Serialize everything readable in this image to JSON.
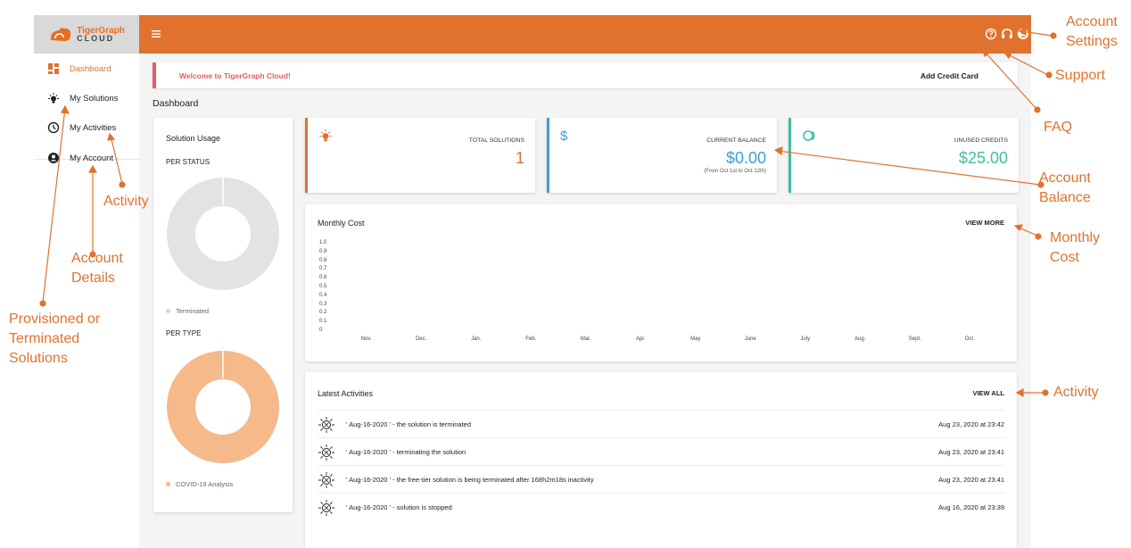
{
  "brand": {
    "name_top": "TigerGraph",
    "name_bottom": "CLOUD"
  },
  "colors": {
    "accent": "#e0722e",
    "welcome": "#e35d64",
    "balance": "#3aa0d8",
    "credits": "#3dbfa0",
    "donut_gray": "#e3e3e3",
    "donut_orange": "#f5b98a"
  },
  "topbar": {
    "icons": [
      "menu-icon",
      "help-icon",
      "headset-icon",
      "account-circle-icon"
    ]
  },
  "sidebar": {
    "items": [
      {
        "label": "Dashboard",
        "icon": "dashboard-icon",
        "active": true
      },
      {
        "label": "My Solutions",
        "icon": "solution-icon",
        "active": false
      },
      {
        "label": "My Activities",
        "icon": "clock-icon",
        "active": false
      },
      {
        "label": "My Account",
        "icon": "account-circle-icon",
        "active": false
      }
    ]
  },
  "welcome": {
    "text": "Welcome to TigerGraph Cloud!",
    "action": "Add Credit Card"
  },
  "page_title": "Dashboard",
  "usage": {
    "title": "Solution Usage",
    "per_status": "PER STATUS",
    "status_legend": "Terminated",
    "per_type": "PER TYPE",
    "type_legend": "COVID-19 Analysis"
  },
  "stats": [
    {
      "label": "TOTAL SOLUTIONS",
      "value": "1",
      "sub": ""
    },
    {
      "label": "CURRENT BALANCE",
      "value": "$0.00",
      "sub": "(From Oct 1st to Oct 12th)"
    },
    {
      "label": "UNUSED CREDITS",
      "value": "$25.00",
      "sub": ""
    }
  ],
  "monthly_cost": {
    "title": "Monthly Cost",
    "action": "VIEW MORE"
  },
  "chart_data": {
    "type": "bar",
    "title": "Monthly Cost",
    "categories": [
      "Nov.",
      "Dec.",
      "Jan.",
      "Feb.",
      "Mar.",
      "Apr.",
      "May",
      "June",
      "July",
      "Aug.",
      "Sept.",
      "Oct."
    ],
    "values": [
      0,
      0,
      0,
      0,
      0,
      0,
      0,
      0,
      0,
      0,
      0,
      0
    ],
    "yticks": [
      "1.0",
      "0.9",
      "0.8",
      "0.7",
      "0.6",
      "0.5",
      "0.4",
      "0.3",
      "0.2",
      "0.1",
      "0"
    ],
    "ylim": [
      0,
      1.0
    ],
    "grid": false
  },
  "activities": {
    "title": "Latest Activities",
    "action": "VIEW ALL",
    "rows": [
      {
        "text": "' Aug-16-2020 ' - the solution is terminated",
        "time": "Aug 23, 2020 at 23:42"
      },
      {
        "text": "' Aug-16-2020 ' - terminating the solution",
        "time": "Aug 23, 2020 at 23:41"
      },
      {
        "text": "' Aug-16-2020 ' - the free-tier solution is being terminated after 168h2m18s inactivity",
        "time": "Aug 23, 2020 at 23:41"
      },
      {
        "text": "' Aug-16-2020 ' - solution is stopped",
        "time": "Aug 16, 2020 at 23:39"
      }
    ]
  },
  "annotations": {
    "account_settings": "Account\nSettings",
    "support": "Support",
    "faq": "FAQ",
    "account_balance": "Account\nBalance",
    "monthly_cost": "Monthly\nCost",
    "activity_right": "Activity",
    "activity_left": "Activity",
    "account_details": "Account\nDetails",
    "solutions": "Provisioned or\nTerminated\nSolutions"
  }
}
